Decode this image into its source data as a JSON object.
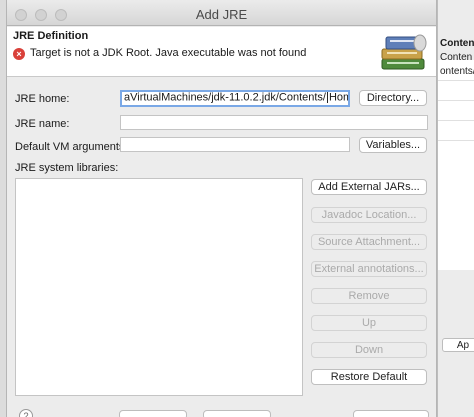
{
  "background": {
    "right_header": "Conten",
    "right_rows": [
      "Conten",
      "ontents/H"
    ],
    "right_button": "Ap"
  },
  "dialog": {
    "title": "Add JRE",
    "banner": {
      "title": "JRE Definition",
      "error": "Target is not a JDK Root. Java executable was not found"
    },
    "jre_home": {
      "label": "JRE home:",
      "value_before_caret": "aVirtualMachines/jdk-11.0.2.jdk/Contents/",
      "value_after_caret": "Home/lib",
      "button": "Directory..."
    },
    "jre_name": {
      "label": "JRE name:",
      "value": ""
    },
    "vm_args": {
      "label": "Default VM arguments:",
      "value": "",
      "button": "Variables..."
    },
    "libraries": {
      "label": "JRE system libraries:",
      "buttons": {
        "add_external_jars": "Add External JARs...",
        "javadoc_location": "Javadoc Location...",
        "source_attachment": "Source Attachment...",
        "external_annotations": "External annotations...",
        "remove": "Remove",
        "up": "Up",
        "down": "Down",
        "restore_default": "Restore Default"
      }
    },
    "help_icon": "?"
  },
  "colors": {
    "focus_ring": "#7aa8e6",
    "error": "#d9403a",
    "dialog_bg": "#ececec"
  }
}
